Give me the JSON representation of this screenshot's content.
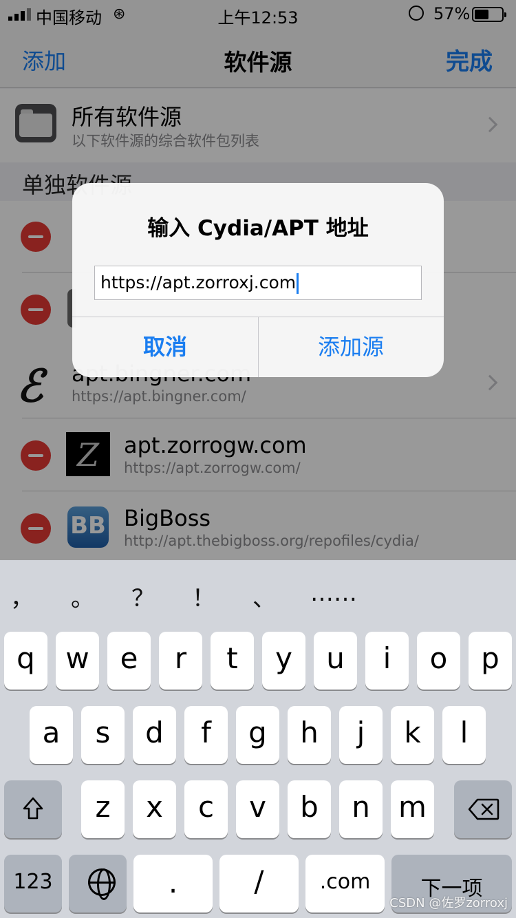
{
  "status_bar": {
    "carrier": "中国移动",
    "time": "上午12:53",
    "battery_percent": "57%",
    "battery_level": 0.57
  },
  "nav": {
    "left": "添加",
    "title": "软件源",
    "right": "完成"
  },
  "all_sources": {
    "title": "所有软件源",
    "subtitle": "以下软件源的综合软件包列表"
  },
  "section_header": "单独软件源",
  "sources": [
    {
      "title": "apt.bingner.com",
      "url": "https://apt.bingner.com/",
      "icon": "bingner-script-e-icon"
    },
    {
      "title": "apt.zorrogw.com",
      "url": "https://apt.zorrogw.com/",
      "icon": "zorro-z-icon"
    },
    {
      "title": "BigBoss",
      "url": "http://apt.thebigboss.org/repofiles/cydia/",
      "icon": "bigboss-bb-icon"
    }
  ],
  "icons": {
    "bingner_glyph": "ℰ",
    "zorro_glyph": "Z",
    "bigboss_glyph": "BB"
  },
  "dialog": {
    "title": "输入 Cydia/APT 地址",
    "input_value": "https://apt.zorroxj.com",
    "cancel": "取消",
    "confirm": "添加源"
  },
  "keyboard": {
    "suggestions": [
      "，",
      "。",
      "？",
      "！",
      "、",
      "……"
    ],
    "row1": [
      "q",
      "w",
      "e",
      "r",
      "t",
      "y",
      "u",
      "i",
      "o",
      "p"
    ],
    "row2": [
      "a",
      "s",
      "d",
      "f",
      "g",
      "h",
      "j",
      "k",
      "l"
    ],
    "row3": [
      "z",
      "x",
      "c",
      "v",
      "b",
      "n",
      "m"
    ],
    "numbers_key": "123",
    "dot_key": ".",
    "slash_key": "/",
    "com_key": ".com",
    "next_key": "下一项"
  },
  "colors": {
    "accent": "#1a7df0",
    "delete_red": "#e53935"
  },
  "watermark": "CSDN @佐罗zorroxj"
}
